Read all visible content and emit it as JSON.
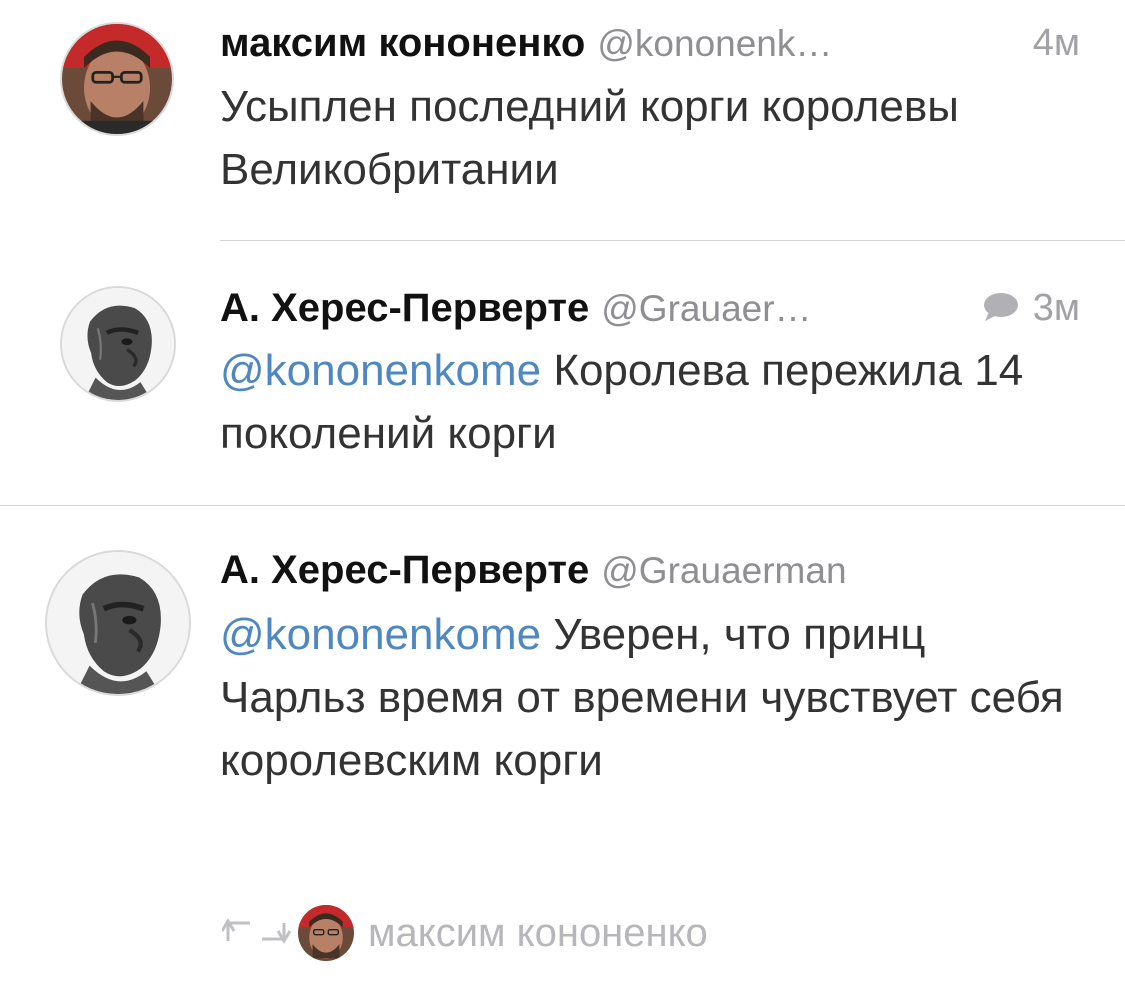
{
  "tweets": [
    {
      "name": "максим кононенко",
      "handle": "@kononenk…",
      "time": "4м",
      "text": "Усыплен последний корги королевы Великобритании",
      "has_reply_icon": false
    },
    {
      "name": "А. Херес-Перверте",
      "handle": "@Grauaer…",
      "time": "3м",
      "mention": "@kononenkome",
      "text": " Королева пережила 14 поколений корги",
      "has_reply_icon": true
    },
    {
      "name": "А. Херес-Перверте",
      "handle": "@Grauaerman",
      "time": "",
      "mention": "@kononenkome",
      "text": " Уверен, что принц Чарльз время от времени чувствует себя королевским корги",
      "retweeted_by": "максим кононенко"
    }
  ],
  "icons": {
    "reply": "speech-bubble-icon",
    "retweet": "retweet-icon",
    "avatar1": "user-photo-man-glasses",
    "avatar2": "statue-face"
  },
  "colors": {
    "mention": "#4f87c1",
    "meta_gray": "#a1a1a6",
    "divider": "#d4d4d8"
  }
}
